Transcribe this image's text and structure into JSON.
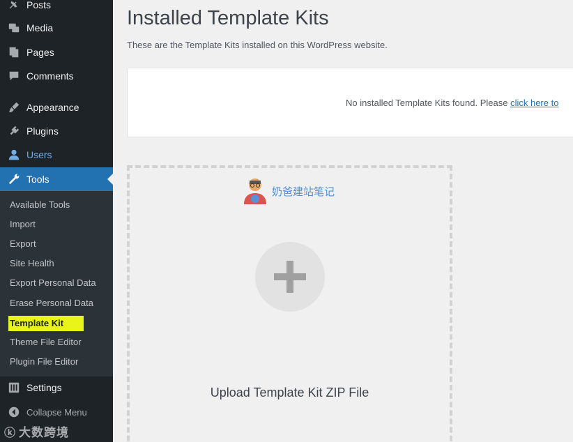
{
  "sidebar": {
    "items": [
      {
        "label": "Posts",
        "icon": "pin-icon"
      },
      {
        "label": "Media",
        "icon": "media-icon"
      },
      {
        "label": "Pages",
        "icon": "pages-icon"
      },
      {
        "label": "Comments",
        "icon": "comment-icon"
      },
      {
        "label": "Appearance",
        "icon": "brush-icon"
      },
      {
        "label": "Plugins",
        "icon": "plugin-icon"
      },
      {
        "label": "Users",
        "icon": "user-icon"
      },
      {
        "label": "Tools",
        "icon": "wrench-icon"
      },
      {
        "label": "Settings",
        "icon": "settings-icon"
      }
    ],
    "submenu": [
      "Available Tools",
      "Import",
      "Export",
      "Site Health",
      "Export Personal Data",
      "Erase Personal Data",
      "Template Kit",
      "Theme File Editor",
      "Plugin File Editor"
    ],
    "collapse_label": "Collapse Menu",
    "watermark": "大数跨境"
  },
  "main": {
    "title": "Installed Template Kits",
    "subtitle": "These are the Template Kits installed on this WordPress website.",
    "notice": "No installed Template Kits found. Please",
    "notice_link": "click here to",
    "upload_label": "Upload Template Kit ZIP File",
    "brand_text": "奶爸建站笔记"
  },
  "colors": {
    "sidebar_bg": "#1d2327",
    "active_bg": "#2271b1",
    "highlight": "#e9f51a",
    "link": "#2271b1"
  }
}
